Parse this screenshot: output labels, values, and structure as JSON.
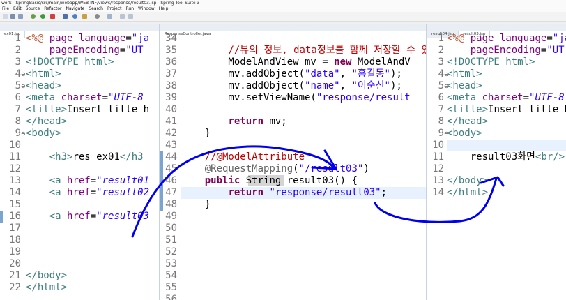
{
  "window": {
    "title": "work - SpringBasic/src/main/webapp/WEB-INF/views/response/result03.jsp - Spring Tool Suite 3"
  },
  "menu": [
    "File",
    "Edit",
    "Source",
    "Refactor",
    "Navigate",
    "Search",
    "Project",
    "Run",
    "Window",
    "Help"
  ],
  "panes": [
    {
      "tabs": [
        {
          "label": "ex01.jsp",
          "active": true
        }
      ],
      "lines": [
        {
          "n": "1",
          "m": "",
          "html": "<span class='dir'>&lt;%@</span> <span class='attr'>page</span> <span class='attr'>language</span>=<span class='str'>\"ja</span>"
        },
        {
          "n": "2",
          "m": "",
          "html": "    <span class='attr'>pageEncoding</span>=<span class='str'>\"UT</span>"
        },
        {
          "n": "3",
          "m": "",
          "html": "<span class='tag'>&lt;!DOCTYPE html&gt;</span>"
        },
        {
          "n": "4",
          "m": "⊖",
          "html": "<span class='tag'>&lt;html&gt;</span>"
        },
        {
          "n": "5",
          "m": "⊖",
          "html": "<span class='tag'>&lt;head&gt;</span>"
        },
        {
          "n": "6",
          "m": "",
          "html": "<span class='tag'>&lt;meta</span> <span class='attr'>charset</span>=<span class='str'><i>\"UTF-8</i></span>"
        },
        {
          "n": "7",
          "m": "",
          "html": "<span class='tag'>&lt;title&gt;</span>Insert title h"
        },
        {
          "n": "8",
          "m": "",
          "html": "<span class='tag'>&lt;/head&gt;</span>"
        },
        {
          "n": "9",
          "m": "⊖",
          "html": "<span class='tag'>&lt;body&gt;</span>"
        },
        {
          "n": "10",
          "m": "",
          "html": ""
        },
        {
          "n": "11",
          "m": "",
          "html": "    <span class='tag'>&lt;h3&gt;</span>res ex01<span class='tag'>&lt;/h3</span>"
        },
        {
          "n": "12",
          "m": "",
          "html": ""
        },
        {
          "n": "13",
          "m": "",
          "html": "    <span class='tag'>&lt;a</span> <span class='attr'>href</span>=<span class='str'><i>\"result01</i></span>"
        },
        {
          "n": "14",
          "m": "",
          "html": "    <span class='tag'>&lt;a</span> <span class='attr'>href</span>=<span class='str'><i>\"result02</i></span>"
        },
        {
          "n": "15",
          "m": "",
          "html": ""
        },
        {
          "n": "16",
          "m": "",
          "html": "    <span class='tag'>&lt;a</span> <span class='attr'>href</span>=<span class='str'><i>\"result03</i></span>"
        },
        {
          "n": "17",
          "m": "",
          "html": ""
        },
        {
          "n": "18",
          "m": "",
          "html": ""
        },
        {
          "n": "19",
          "m": "",
          "html": ""
        },
        {
          "n": "20",
          "m": "",
          "html": ""
        },
        {
          "n": "21",
          "m": "",
          "html": "<span class='tag'>&lt;/body&gt;</span>"
        },
        {
          "n": "22",
          "m": "",
          "html": "<span class='tag'>&lt;/html&gt;</span>"
        }
      ]
    },
    {
      "tabs": [
        {
          "label": "ResponseController.java",
          "active": true
        }
      ],
      "lines": [
        {
          "n": "34",
          "m": "",
          "html": ""
        },
        {
          "n": "35",
          "m": "",
          "html": "        <span class='cmt'>//뷰의 정보, data정보를 함께 저장할 수 있</span>"
        },
        {
          "n": "36",
          "m": "",
          "html": "        ModelAndView mv = <span class='kw'>new</span> ModelAndV"
        },
        {
          "n": "37",
          "m": "",
          "html": "        mv.addObject(<span class='str'>\"data\"</span>, <span class='str'>\"홍길동\"</span>);"
        },
        {
          "n": "38",
          "m": "",
          "html": "        mv.addObject(<span class='str'>\"name\"</span>, <span class='str'>\"이순신\"</span>);"
        },
        {
          "n": "39",
          "m": "",
          "html": "        mv.setViewName(<span class='str'>\"response/result</span>"
        },
        {
          "n": "40",
          "m": "",
          "html": ""
        },
        {
          "n": "41",
          "m": "",
          "html": "        <span class='kw'>return</span> mv;"
        },
        {
          "n": "42",
          "m": "",
          "html": "    }"
        },
        {
          "n": "43",
          "m": "",
          "html": ""
        },
        {
          "n": "44",
          "m": "",
          "html": "    <span class='cmt'>//@ModelAttribute</span>"
        },
        {
          "n": "45",
          "m": "",
          "html": "    <span class='ann'>@RequestMapping</span>(<span class='str'>\"/result03\"</span>)"
        },
        {
          "n": "46",
          "m": "",
          "html": "    <span class='kw'>public</span> String result03() {"
        },
        {
          "n": "47",
          "m": "",
          "html": "        <span class='kw'>return</span> <span class='str'>\"response/result03\"</span>;"
        },
        {
          "n": "48",
          "m": "",
          "html": "    }"
        },
        {
          "n": "49",
          "m": "",
          "html": ""
        },
        {
          "n": "50",
          "m": "",
          "html": ""
        },
        {
          "n": "51",
          "m": "",
          "html": ""
        },
        {
          "n": "52",
          "m": "",
          "html": ""
        },
        {
          "n": "53",
          "m": "",
          "html": ""
        },
        {
          "n": "54",
          "m": "",
          "html": ""
        },
        {
          "n": "55",
          "m": "",
          "html": ""
        },
        {
          "n": "56",
          "m": "",
          "html": ""
        }
      ]
    },
    {
      "tabs": [
        {
          "label": "result04.jsp",
          "active": false
        },
        {
          "label": "result03.jsp",
          "active": true
        }
      ],
      "lines": [
        {
          "n": "1",
          "m": "",
          "html": "<span class='dir'>&lt;%@</span> <span class='attr'>page</span> <span class='attr'>language</span>=<span class='str'>\"ja</span>"
        },
        {
          "n": "2",
          "m": "",
          "html": "    <span class='attr'>pageEncoding</span>=<span class='str'>\"UT</span>"
        },
        {
          "n": "3",
          "m": "",
          "html": "<span class='tag'>&lt;!DOCTYPE html&gt;</span>"
        },
        {
          "n": "4",
          "m": "⊖",
          "html": "<span class='tag'>&lt;html&gt;</span>"
        },
        {
          "n": "5",
          "m": "⊖",
          "html": "<span class='tag'>&lt;head&gt;</span>"
        },
        {
          "n": "6",
          "m": "",
          "html": "<span class='tag'>&lt;meta</span> <span class='attr'>charset</span>=<span class='str'><i>\"UTF-8</i></span>"
        },
        {
          "n": "7",
          "m": "",
          "html": "<span class='tag'>&lt;title&gt;</span>Insert title h"
        },
        {
          "n": "8",
          "m": "",
          "html": "<span class='tag'>&lt;/head&gt;</span>"
        },
        {
          "n": "9",
          "m": "⊖",
          "html": "<span class='tag'>&lt;body&gt;</span>"
        },
        {
          "n": "10",
          "m": "",
          "html": ""
        },
        {
          "n": "11",
          "m": "",
          "html": "    result03화면<span class='tag'>&lt;br/&gt;</span>"
        },
        {
          "n": "12",
          "m": "",
          "html": ""
        },
        {
          "n": "13",
          "m": "",
          "html": "<span class='tag'>&lt;/body&gt;</span>"
        },
        {
          "n": "14",
          "m": "",
          "html": "<span class='tag'>&lt;/html&gt;</span>"
        }
      ]
    }
  ]
}
